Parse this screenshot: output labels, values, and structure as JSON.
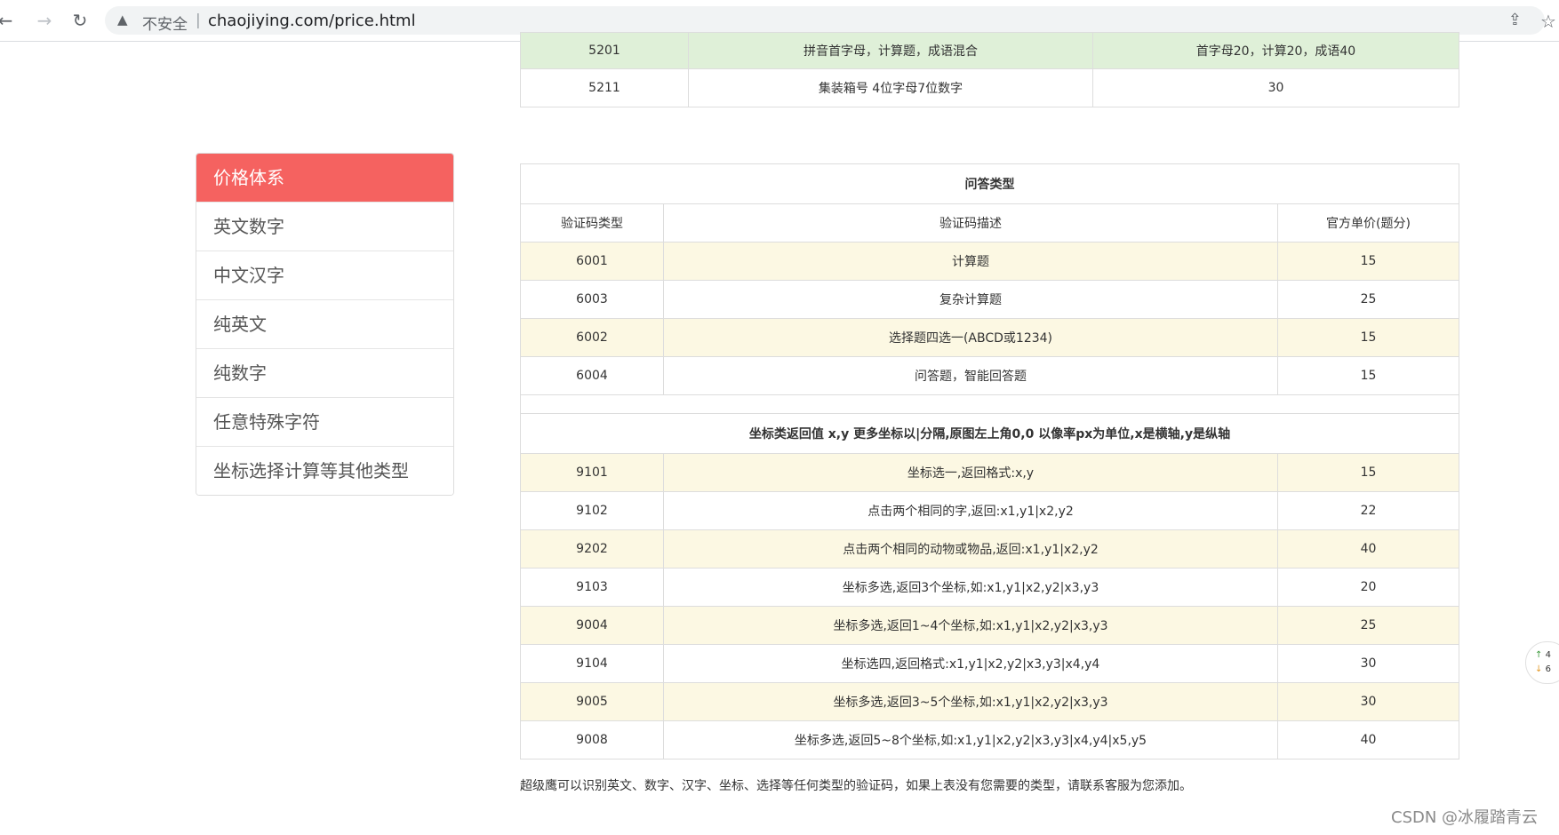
{
  "browser": {
    "insecure_label": "不安全",
    "separator": "|",
    "url": "chaojiying.com/price.html"
  },
  "top_table": {
    "rows": [
      [
        "5201",
        "拼音首字母，计算题，成语混合",
        "首字母20，计算20，成语40"
      ],
      [
        "5211",
        "集装箱号 4位字母7位数字",
        "30"
      ]
    ]
  },
  "sidebar": {
    "items": [
      {
        "label": "价格体系",
        "active": true
      },
      {
        "label": "英文数字"
      },
      {
        "label": "中文汉字"
      },
      {
        "label": "纯英文"
      },
      {
        "label": "纯数字"
      },
      {
        "label": "任意特殊字符"
      },
      {
        "label": "坐标选择计算等其他类型"
      }
    ]
  },
  "main_table": {
    "title": "问答类型",
    "headers": [
      "验证码类型",
      "验证码描述",
      "官方单价(题分)"
    ],
    "qa_rows": [
      [
        "6001",
        "计算题",
        "15"
      ],
      [
        "6003",
        "复杂计算题",
        "25"
      ],
      [
        "6002",
        "选择题四选一(ABCD或1234)",
        "15"
      ],
      [
        "6004",
        "问答题，智能回答题",
        "15"
      ]
    ],
    "coord_title": "坐标类返回值 x,y 更多坐标以|分隔,原图左上角0,0 以像率px为单位,x是横轴,y是纵轴",
    "coord_rows": [
      [
        "9101",
        "坐标选一,返回格式:x,y",
        "15"
      ],
      [
        "9102",
        "点击两个相同的字,返回:x1,y1|x2,y2",
        "22"
      ],
      [
        "9202",
        "点击两个相同的动物或物品,返回:x1,y1|x2,y2",
        "40"
      ],
      [
        "9103",
        "坐标多选,返回3个坐标,如:x1,y1|x2,y2|x3,y3",
        "20"
      ],
      [
        "9004",
        "坐标多选,返回1~4个坐标,如:x1,y1|x2,y2|x3,y3",
        "25"
      ],
      [
        "9104",
        "坐标选四,返回格式:x1,y1|x2,y2|x3,y3|x4,y4",
        "30"
      ],
      [
        "9005",
        "坐标多选,返回3~5个坐标,如:x1,y1|x2,y2|x3,y3",
        "30"
      ],
      [
        "9008",
        "坐标多选,返回5~8个坐标,如:x1,y1|x2,y2|x3,y3|x4,y4|x5,y5",
        "40"
      ]
    ]
  },
  "footer_note": "超级鹰可以识别英文、数字、汉字、坐标、选择等任何类型的验证码，如果上表没有您需要的类型，请联系客服为您添加。",
  "watermark": "CSDN @冰履踏青云",
  "side_widget": {
    "up": "4",
    "down": "6"
  },
  "colors": {
    "active_red": "#f56260",
    "row_yellow": "#fcf8e3",
    "row_green": "#dff0d8"
  }
}
